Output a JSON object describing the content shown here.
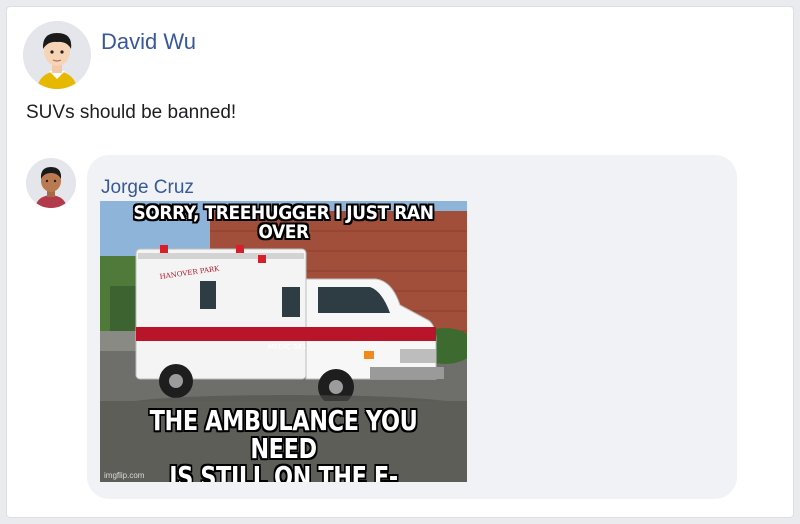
{
  "post": {
    "author": "David Wu",
    "text": "SUVs should be banned!"
  },
  "reply": {
    "author": "Jorge Cruz",
    "meme": {
      "top_text": "SORRY, TREEHUGGER I JUST RAN OVER",
      "bottom_line1": "THE AMBULANCE YOU NEED",
      "bottom_line2": "IS STILL ON THE E-CHARGER",
      "vehicle_label": "MEDIC 381",
      "watermark": "imgflip.com"
    }
  },
  "colors": {
    "name_link": "#385898",
    "bubble": "#f0f2f5",
    "ambulance_stripe": "#b8152b"
  }
}
